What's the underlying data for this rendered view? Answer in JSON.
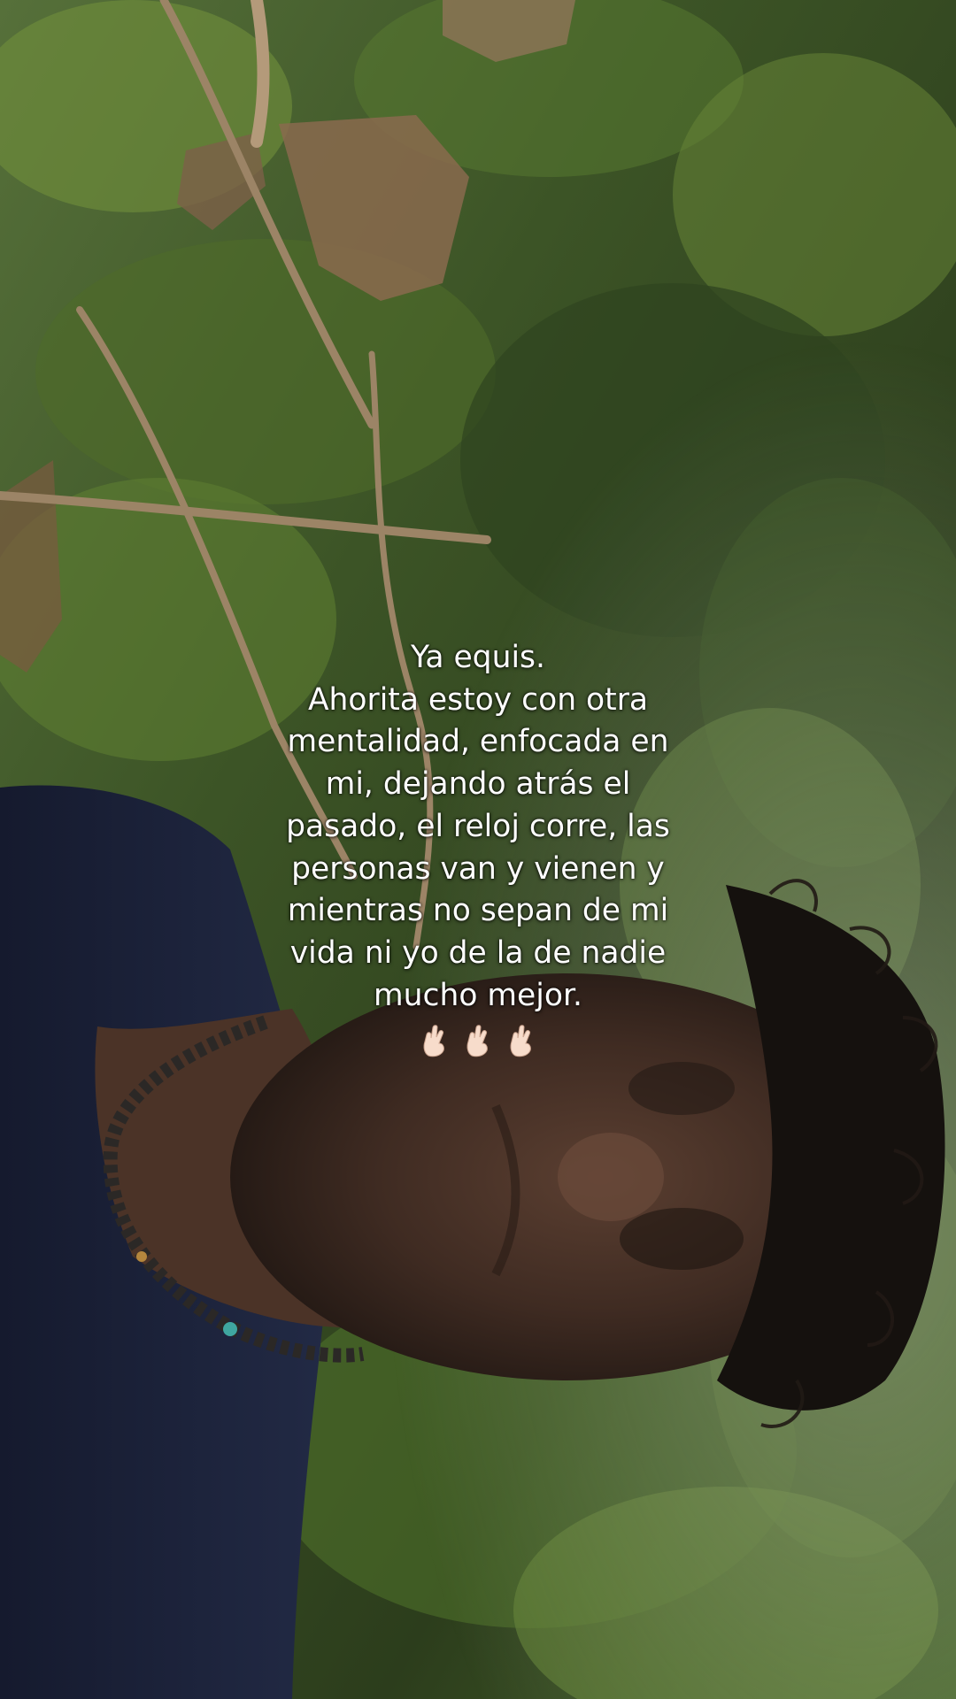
{
  "caption": {
    "lines": [
      "Ya equis.",
      "Ahorita estoy con otra",
      "mentalidad, enfocada en",
      "mi, dejando atrás el",
      "pasado, el reloj corre, las",
      "personas van y vienen y",
      "mientras no sepan de mi",
      "vida ni yo de la de nadie",
      "mucho mejor."
    ],
    "emoji": [
      "crossed-fingers-icon",
      "crossed-fingers-icon",
      "crossed-fingers-icon"
    ]
  },
  "colors": {
    "foliage_dark": "#1f2a16",
    "foliage_mid": "#3f5a26",
    "foliage_light": "#6f8f3c",
    "shirt": "#1b2036",
    "skin": "#4a3328",
    "hair": "#15110e",
    "caption_text": "#ffffff"
  }
}
